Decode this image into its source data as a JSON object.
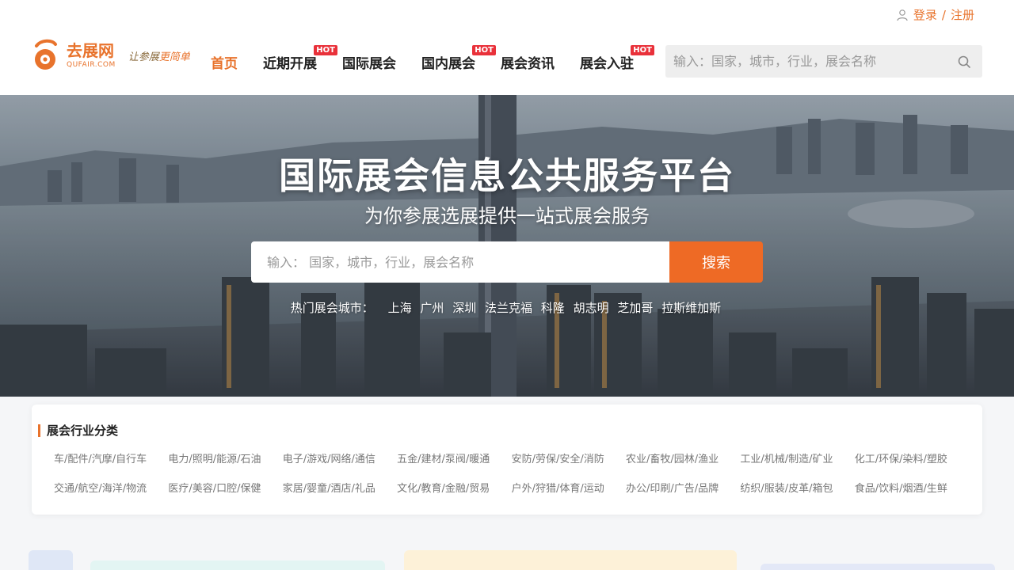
{
  "header": {
    "auth": {
      "login": "登录",
      "separator": "/",
      "register": "注册"
    },
    "logo": {
      "name_cn": "去展网",
      "name_en": "QUFAIR.COM",
      "slogan_prefix": "让参展",
      "slogan_highlight": "更简单"
    },
    "nav": [
      {
        "label": "首页",
        "hot": false,
        "active": true
      },
      {
        "label": "近期开展",
        "hot": true,
        "active": false
      },
      {
        "label": "国际展会",
        "hot": false,
        "active": false
      },
      {
        "label": "国内展会",
        "hot": true,
        "active": false
      },
      {
        "label": "展会资讯",
        "hot": false,
        "active": false
      },
      {
        "label": "展会入驻",
        "hot": true,
        "active": false
      }
    ],
    "hot_badge": "HOT",
    "search_placeholder": "输入：国家，城市，行业，展会名称"
  },
  "hero": {
    "title": "国际展会信息公共服务平台",
    "subtitle": "为你参展选展提供一站式展会服务",
    "search_placeholder": "输入： 国家，城市，行业，展会名称",
    "search_button": "搜索",
    "hot_cities_label": "热门展会城市：",
    "hot_cities": [
      "上海",
      "广州",
      "深圳",
      "法兰克福",
      "科隆",
      "胡志明",
      "芝加哥",
      "拉斯维加斯"
    ]
  },
  "categories": {
    "title": "展会行业分类",
    "items": [
      "车/配件/汽摩/自行车",
      "电力/照明/能源/石油",
      "电子/游戏/网络/通信",
      "五金/建材/泵阀/暖通",
      "安防/劳保/安全/消防",
      "农业/畜牧/园林/渔业",
      "工业/机械/制造/矿业",
      "化工/环保/染料/塑胶",
      "交通/航空/海洋/物流",
      "医疗/美容/口腔/保健",
      "家居/婴童/酒店/礼品",
      "文化/教育/金融/贸易",
      "户外/狩猎/体育/运动",
      "办公/印刷/广告/品牌",
      "纺织/服装/皮革/箱包",
      "食品/饮料/烟酒/生鲜"
    ]
  },
  "colors": {
    "accent": "#e8732c",
    "search_button": "#ee6a25",
    "hot_badge": "#e9313a"
  }
}
